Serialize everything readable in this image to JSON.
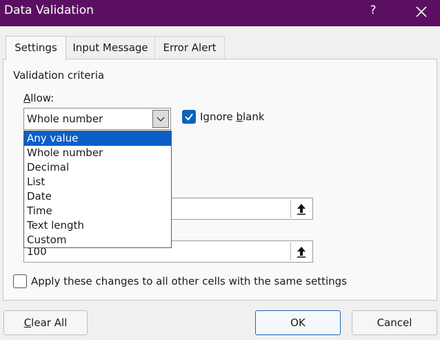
{
  "window": {
    "title": "Data Validation",
    "help": "?"
  },
  "tabs": [
    "Settings",
    "Input Message",
    "Error Alert"
  ],
  "settings": {
    "section_title": "Validation criteria",
    "allow": {
      "label_key": "A",
      "label_rest": "llow:",
      "selected": "Whole number",
      "options": [
        "Any value",
        "Whole number",
        "Decimal",
        "List",
        "Date",
        "Time",
        "Text length",
        "Custom"
      ],
      "highlighted_option": "Any value"
    },
    "ignore_blank": {
      "label_pre": "Ignore ",
      "label_key": "b",
      "label_post": "lank",
      "checked": true
    },
    "minimum_value": "",
    "maximum_value": "100",
    "apply_all": {
      "label_pre": "Apply these changes to all other cells with the same settings",
      "checked": false
    }
  },
  "buttons": {
    "clear_key": "C",
    "clear_rest": "lear All",
    "ok": "OK",
    "cancel": "Cancel"
  },
  "colors": {
    "titlebar": "#5b0f62",
    "accent": "#0a64b9",
    "selection": "#0b5fc6"
  }
}
